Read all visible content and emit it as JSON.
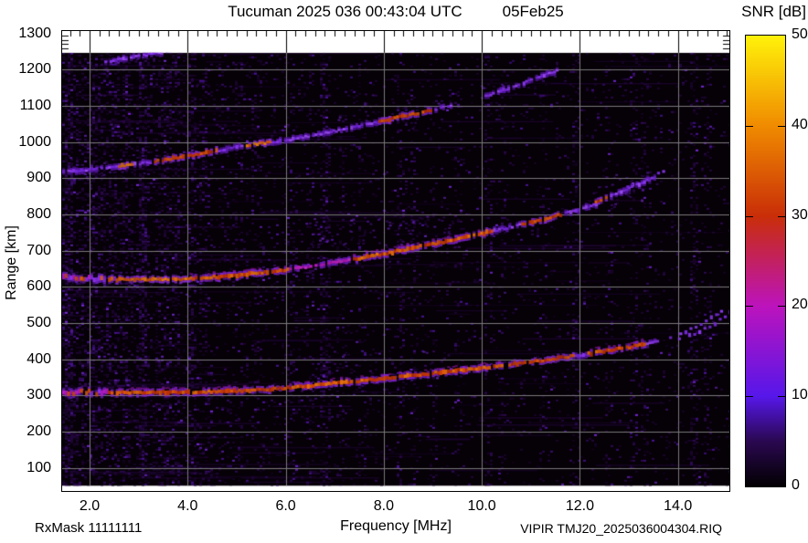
{
  "header": {
    "title": "Tucuman 2025 036 00:43:04 UTC",
    "date": "05Feb25",
    "colorbar_title": "SNR [dB]"
  },
  "footer": {
    "rx_mask": "RxMask 11111111",
    "file_label": "VIPIR  TMJ20_2025036004304.RIQ"
  },
  "chart_data": {
    "type": "heatmap",
    "title": "Tucuman 2025 036 00:43:04 UTC   05Feb25",
    "xlabel": "Frequency [MHz]",
    "ylabel": "Range [km]",
    "colorbar_label": "SNR [dB]",
    "xlim": [
      1.44,
      15.05
    ],
    "ylim": [
      36,
      1307
    ],
    "x_ticks": [
      2,
      4,
      6,
      8,
      10,
      12,
      14
    ],
    "x_tick_labels": [
      "2.0",
      "4.0",
      "6.0",
      "8.0",
      "10.0",
      "12.0",
      "14.0"
    ],
    "y_ticks": [
      1300,
      1200,
      1100,
      1000,
      900,
      800,
      700,
      600,
      500,
      400,
      300,
      200,
      100
    ],
    "y_tick_labels": [
      "1300",
      "1200",
      "1100",
      "1000",
      "900",
      "800",
      "700",
      "600",
      "500",
      "400",
      "300",
      "200",
      "100"
    ],
    "grid": true,
    "data_region_km": [
      50,
      1247
    ],
    "colorbar": {
      "range": [
        0,
        50
      ],
      "ticks": [
        50,
        40,
        30,
        20,
        10,
        0
      ],
      "tick_labels": [
        "50",
        "40",
        "30",
        "20",
        "10",
        "0"
      ],
      "inner_dash_values": [
        10,
        20,
        30,
        40
      ],
      "gradient_stops": [
        [
          "0%",
          "#020002"
        ],
        [
          "10%",
          "#2a0850"
        ],
        [
          "20%",
          "#5617ea"
        ],
        [
          "40%",
          "#bc13bc"
        ],
        [
          "60%",
          "#c92e08"
        ],
        [
          "80%",
          "#f08b00"
        ],
        [
          "100%",
          "#fff20a"
        ]
      ]
    },
    "colors": {
      "plot_background": "#060007",
      "page_background": "#ffffff",
      "gridline": "#7a7a7a",
      "frame": "#000000",
      "noise_shades": [
        "#1d0533",
        "#340b5e",
        "#4e14a0",
        "#7a2be0"
      ],
      "cloud_shades": [
        "#3a0d68",
        "#55189e",
        "#7026d2",
        "#8838ea"
      ],
      "streak": "#2a0848"
    },
    "styles": {
      "hot": {
        "cores": [
          "#d14109",
          "#e0580b",
          "#e8700d",
          "#c03208"
        ],
        "halo": "#8824e0",
        "halo2": "#b01cc0",
        "h": 4,
        "skip": 0.04,
        "jitter": 1
      },
      "hot2": {
        "cores": [
          "#c83d0a",
          "#d4560e",
          "#b22c0e"
        ],
        "halo": "#8a2ae0",
        "h": 3.6,
        "skip": 0.12,
        "jitter": 1
      },
      "orange": {
        "cores": [
          "#dd6a10",
          "#cc5210",
          "#e07a12"
        ],
        "halo": "#9030e0",
        "h": 3.4,
        "skip": 0.08,
        "jitter": 1
      },
      "mixed": {
        "cores": [
          "#d45c0c",
          "#8a30e8",
          "#b01cc0",
          "#c84a0c"
        ],
        "halo": "#7020c8",
        "h": 5,
        "skip": 0.18,
        "jitter": 2
      },
      "magenta": {
        "cores": [
          "#bb1abe",
          "#a518b4",
          "#c32cc8"
        ],
        "halo": "#7a1fd8",
        "h": 3.2,
        "skip": 0.1,
        "jitter": 1
      },
      "violet": {
        "cores": [
          "#8834ec",
          "#7326da",
          "#9a4af2"
        ],
        "halo": "#5c16b0",
        "h": 3,
        "skip": 0.12,
        "jitter": 1
      },
      "vsparse": {
        "cores": [
          "#8c3af0",
          "#7a2ae0"
        ],
        "halo": null,
        "h": 3,
        "skip": 0.15,
        "jitter": 1.5
      }
    },
    "echo_traces": [
      {
        "name": "hop4-fragment-low-freq",
        "points": [
          [
            2.3,
            1222
          ],
          [
            2.95,
            1237
          ],
          [
            3.6,
            1251
          ]
        ],
        "segments": [
          [
            2.3,
            3.6,
            "violet"
          ]
        ]
      },
      {
        "name": "hop3-extension-fragment",
        "points": [
          [
            10.05,
            1126
          ],
          [
            10.6,
            1153
          ],
          [
            11.1,
            1177
          ],
          [
            11.55,
            1199
          ]
        ],
        "segments": [
          [
            10.05,
            11.55,
            "violet"
          ]
        ]
      },
      {
        "name": "hop3-trace",
        "points": [
          [
            1.44,
            918
          ],
          [
            2,
            925
          ],
          [
            3,
            940
          ],
          [
            4,
            962
          ],
          [
            5,
            987
          ],
          [
            6,
            1006
          ],
          [
            7,
            1031
          ],
          [
            8,
            1060
          ],
          [
            9,
            1090
          ],
          [
            9.35,
            1102
          ]
        ],
        "segments": [
          [
            1.44,
            2.55,
            "violet"
          ],
          [
            2.55,
            2.85,
            "orange"
          ],
          [
            2.85,
            3.25,
            "violet"
          ],
          [
            3.25,
            4.6,
            "hot2"
          ],
          [
            4.6,
            5.1,
            "violet"
          ],
          [
            5.1,
            5.7,
            "orange"
          ],
          [
            5.7,
            7.85,
            "violet"
          ],
          [
            7.85,
            8.95,
            "hot2"
          ],
          [
            8.95,
            9.35,
            "violet"
          ]
        ]
      },
      {
        "name": "hop2-tail-upper-arm",
        "points": [
          [
            12.95,
            878
          ],
          [
            13.35,
            900
          ],
          [
            13.7,
            920
          ]
        ],
        "segments": [
          [
            12.95,
            13.7,
            "vsparse"
          ]
        ],
        "dotted": true
      },
      {
        "name": "hop2-tail",
        "points": [
          [
            12.3,
            833
          ],
          [
            12.75,
            860
          ],
          [
            13.2,
            885
          ],
          [
            13.5,
            903
          ]
        ],
        "segments": [
          [
            12.3,
            12.55,
            "hot2"
          ],
          [
            12.55,
            13.5,
            "violet"
          ]
        ]
      },
      {
        "name": "hop2-trace",
        "points": [
          [
            1.44,
            628
          ],
          [
            2,
            623
          ],
          [
            3,
            620
          ],
          [
            4,
            622
          ],
          [
            5,
            632
          ],
          [
            6,
            647
          ],
          [
            7,
            668
          ],
          [
            8,
            692
          ],
          [
            9,
            719
          ],
          [
            10,
            748
          ],
          [
            11,
            779
          ],
          [
            12,
            815
          ],
          [
            12.35,
            829
          ]
        ],
        "segments": [
          [
            1.44,
            2.6,
            "mixed"
          ],
          [
            2.6,
            4.0,
            "orange"
          ],
          [
            4.0,
            6.05,
            "hot"
          ],
          [
            6.05,
            7.3,
            "magenta"
          ],
          [
            7.3,
            10.2,
            "hot"
          ],
          [
            10.2,
            10.75,
            "violet"
          ],
          [
            10.75,
            11.6,
            "hot2"
          ],
          [
            11.6,
            12.35,
            "violet"
          ]
        ]
      },
      {
        "name": "hop1-trace",
        "points": [
          [
            1.44,
            310
          ],
          [
            2,
            308
          ],
          [
            3,
            308
          ],
          [
            4,
            309
          ],
          [
            5,
            312
          ],
          [
            6,
            321
          ],
          [
            7,
            334
          ],
          [
            8,
            347
          ],
          [
            9,
            362
          ],
          [
            10,
            376
          ],
          [
            11,
            393
          ],
          [
            12,
            412
          ],
          [
            13,
            434
          ],
          [
            13.6,
            453
          ]
        ],
        "segments": [
          [
            1.44,
            2.35,
            "mixed"
          ],
          [
            2.35,
            5.2,
            "hot"
          ],
          [
            5.2,
            6.0,
            "hot2"
          ],
          [
            6.0,
            10.4,
            "hot"
          ],
          [
            10.4,
            11.85,
            "hot2"
          ],
          [
            11.85,
            12.1,
            "violet"
          ],
          [
            12.1,
            13.3,
            "hot"
          ],
          [
            13.3,
            13.65,
            "violet"
          ]
        ]
      },
      {
        "name": "hop1-cusp-dotted-outer",
        "points": [
          [
            13.82,
            462
          ],
          [
            14.15,
            478
          ],
          [
            14.45,
            498
          ],
          [
            14.75,
            522
          ],
          [
            15.02,
            550
          ]
        ],
        "segments": [
          [
            13.8,
            15.1,
            "vsparse"
          ]
        ],
        "dotted": true
      },
      {
        "name": "hop1-cusp-dotted-inner",
        "points": [
          [
            14.0,
            456
          ],
          [
            14.3,
            470
          ],
          [
            14.6,
            490
          ],
          [
            14.9,
            512
          ],
          [
            15.05,
            530
          ]
        ],
        "segments": [
          [
            13.9,
            15.1,
            "vsparse"
          ]
        ],
        "dotted": true
      }
    ],
    "diffuse_clouds": [
      {
        "f": [
          1.5,
          4.3
        ],
        "r": [
          60,
          1245
        ],
        "density": 0.035
      },
      {
        "f": [
          6.4,
          9.6
        ],
        "r": [
          695,
          800
        ],
        "density": 0.3
      },
      {
        "f": [
          6.6,
          9.6
        ],
        "r": [
          350,
          425
        ],
        "density": 0.16
      },
      {
        "f": [
          1.44,
          3.1
        ],
        "r": [
          900,
          1005
        ],
        "density": 0.15
      },
      {
        "f": [
          7.0,
          9.35
        ],
        "r": [
          1040,
          1135
        ],
        "density": 0.14
      },
      {
        "f": [
          12.25,
          13.65
        ],
        "r": [
          830,
          918
        ],
        "density": 0.25
      },
      {
        "f": [
          1.44,
          2.7
        ],
        "r": [
          595,
          655
        ],
        "density": 0.2
      },
      {
        "f": [
          1.44,
          2.5
        ],
        "r": [
          295,
          345
        ],
        "density": 0.2
      },
      {
        "f": [
          2.2,
          3.7
        ],
        "r": [
          1205,
          1252
        ],
        "density": 0.2
      },
      {
        "f": [
          13.6,
          15.0
        ],
        "r": [
          440,
          565
        ],
        "density": 0.05
      },
      {
        "f": [
          9.9,
          11.7
        ],
        "r": [
          1120,
          1205
        ],
        "density": 0.07
      }
    ],
    "rfi_stripes": [
      [
        1.55,
        0.3
      ],
      [
        2.06,
        0.12
      ],
      [
        2.42,
        0.1
      ],
      [
        2.72,
        0.16
      ],
      [
        3.08,
        0.3
      ],
      [
        3.38,
        0.12
      ],
      [
        3.58,
        0.18
      ],
      [
        3.72,
        0.14
      ],
      [
        4.06,
        0.2
      ],
      [
        4.32,
        0.1
      ],
      [
        5.0,
        0.08
      ],
      [
        5.38,
        0.08
      ],
      [
        6.06,
        0.1
      ],
      [
        6.48,
        0.1
      ],
      [
        6.78,
        0.28
      ],
      [
        7.1,
        0.07
      ],
      [
        7.52,
        0.08
      ],
      [
        8.33,
        0.14
      ],
      [
        8.58,
        0.1
      ],
      [
        9.0,
        0.06
      ],
      [
        9.48,
        0.1
      ],
      [
        10.12,
        0.14
      ],
      [
        10.38,
        0.08
      ],
      [
        11.22,
        0.1
      ],
      [
        11.88,
        0.14
      ],
      [
        12.55,
        0.07
      ],
      [
        13.06,
        0.12
      ],
      [
        13.32,
        0.1
      ],
      [
        14.3,
        0.22
      ],
      [
        14.58,
        0.12
      ]
    ],
    "noise": {
      "base": 0.05,
      "low_freq_boost": 0.28,
      "low_freq_scale": 2.0,
      "row_streaks": 150
    }
  }
}
